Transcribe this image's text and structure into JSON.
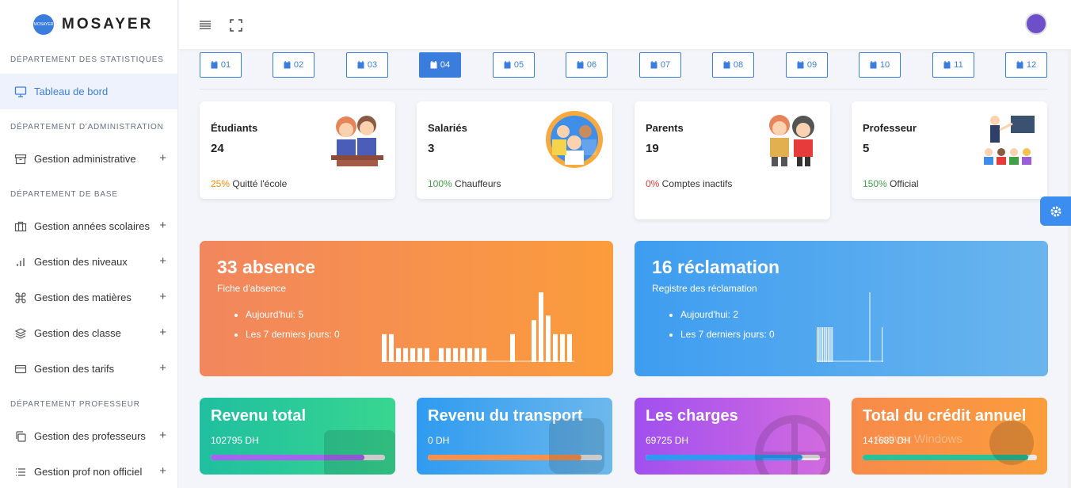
{
  "brand": {
    "name": "MOSAYER",
    "logo_text": "MOSAYER"
  },
  "sidebar": {
    "sections": [
      {
        "title": "DÉPARTEMENT DES STATISTIQUES",
        "items": [
          {
            "label": "Tableau de bord",
            "icon": "monitor-icon",
            "active": true
          }
        ]
      },
      {
        "title": "DÉPARTEMENT D'ADMINISTRATION",
        "items": [
          {
            "label": "Gestion administrative",
            "icon": "archive-icon"
          }
        ]
      },
      {
        "title": "DÉPARTEMENT DE BASE",
        "items": [
          {
            "label": "Gestion années scolaires",
            "icon": "briefcase-icon"
          },
          {
            "label": "Gestion des niveaux",
            "icon": "bar-chart-icon"
          },
          {
            "label": "Gestion des matières",
            "icon": "command-icon"
          },
          {
            "label": "Gestion des classe",
            "icon": "layers-icon"
          },
          {
            "label": "Gestion des tarifs",
            "icon": "credit-card-icon"
          }
        ]
      },
      {
        "title": "DÉPARTEMENT PROFESSEUR",
        "items": [
          {
            "label": "Gestion des professeurs",
            "icon": "copy-icon"
          },
          {
            "label": "Gestion prof non officiel",
            "icon": "list-icon"
          }
        ]
      }
    ],
    "plus": "+"
  },
  "months": [
    "01",
    "02",
    "03",
    "04",
    "05",
    "06",
    "07",
    "08",
    "09",
    "10",
    "11",
    "12"
  ],
  "active_month": "04",
  "stats": [
    {
      "title": "Étudiants",
      "count": "24",
      "pct": "25%",
      "pct_color": "#fb8c00",
      "foot": " Quitté l'école"
    },
    {
      "title": "Salariés",
      "count": "3",
      "pct": "100%",
      "pct_color": "#43a047",
      "foot": " Chauffeurs"
    },
    {
      "title": "Parents",
      "count": "19",
      "pct": "0%",
      "pct_color": "#e53935",
      "foot": " Comptes inactifs"
    },
    {
      "title": "Professeur",
      "count": "5",
      "pct": "150%",
      "pct_color": "#43a047",
      "foot": " Official"
    }
  ],
  "absence": {
    "title": "33 absence",
    "subtitle": "Fiche d'absence",
    "today": "Aujourd'hui: 5",
    "week": "Les 7 derniers jours: 0",
    "chart_data": {
      "type": "bar",
      "values": [
        6,
        6,
        3,
        3,
        3,
        3,
        3,
        0,
        3,
        3,
        3,
        3,
        3,
        3,
        3,
        0,
        0,
        0,
        6,
        0,
        0,
        9,
        15,
        10,
        6,
        6,
        6
      ]
    }
  },
  "reclamation": {
    "title": "16 réclamation",
    "subtitle": "Registre des réclamation",
    "today": "Aujourd'hui: 2",
    "week": "Les 7 derniers jours: 0",
    "chart_data": {
      "type": "bar",
      "values": [
        8,
        8,
        8,
        8,
        8,
        8,
        8,
        8,
        8,
        8,
        8,
        8,
        0,
        0,
        0,
        0,
        0,
        0,
        0,
        0,
        0,
        0,
        0,
        0,
        0,
        0,
        0,
        0,
        0,
        0,
        0,
        0,
        0,
        0,
        0,
        0,
        0,
        0,
        16,
        0,
        0,
        0,
        0,
        0,
        0,
        0,
        0,
        8
      ]
    }
  },
  "revenues": [
    {
      "title": "Revenu total",
      "value": "102795 DH",
      "progress": 0.88,
      "color": "#a564f0"
    },
    {
      "title": "Revenu du transport",
      "value": "0 DH",
      "progress": 0.88,
      "color": "#f5914d"
    },
    {
      "title": "Les charges",
      "value": "69725 DH",
      "progress": 0.9,
      "color": "#2f9bf0"
    },
    {
      "title": "Total du crédit annuel",
      "value": "141689 DH",
      "progress": 0.95,
      "color": "#27c29a"
    }
  ],
  "watermark": "Activer Windows"
}
